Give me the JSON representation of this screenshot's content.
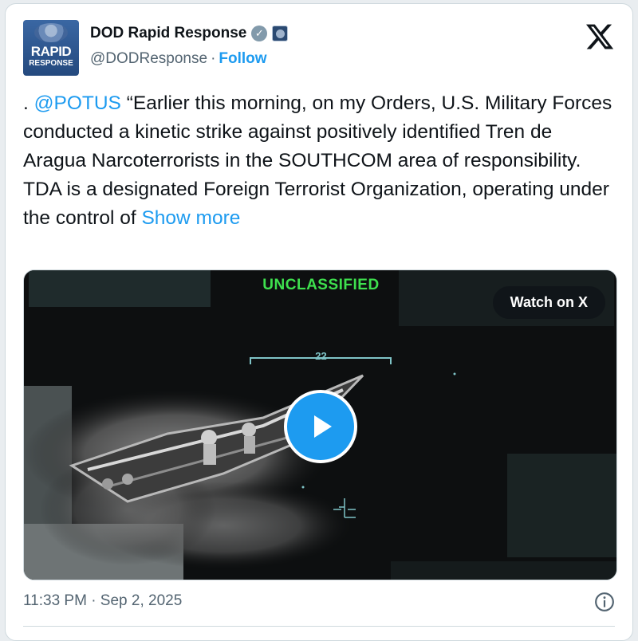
{
  "author": {
    "display_name": "DOD Rapid Response",
    "handle": "@DODResponse",
    "separator": "·",
    "follow_label": "Follow",
    "avatar_text_line1": "RAPID",
    "avatar_text_line2": "RESPONSE",
    "verified_badge": "check-badge",
    "affiliation_badge": "dod-seal-badge"
  },
  "tweet": {
    "lead": ". ",
    "mention": "@POTUS",
    "body": " “Earlier this morning, on my Orders, U.S. Military Forces conducted a kinetic strike against positively identified Tren de Aragua Narcoterrorists in the SOUTHCOM area of responsibility. TDA is a designated Foreign Terrorist Organization, operating under the control of ",
    "show_more": "Show more"
  },
  "media": {
    "overlay_label": "UNCLASSIFIED",
    "hud_number": "22",
    "watch_label": "Watch on X",
    "play_icon": "play-icon"
  },
  "footer": {
    "timestamp": "11:33 PM · Sep 2, 2025",
    "info_icon": "info-icon"
  },
  "colors": {
    "link": "#1d9bf0",
    "text": "#0f1419",
    "muted": "#536471",
    "hud_green": "#3ee04e",
    "hud_cyan": "#7fc4c7"
  }
}
